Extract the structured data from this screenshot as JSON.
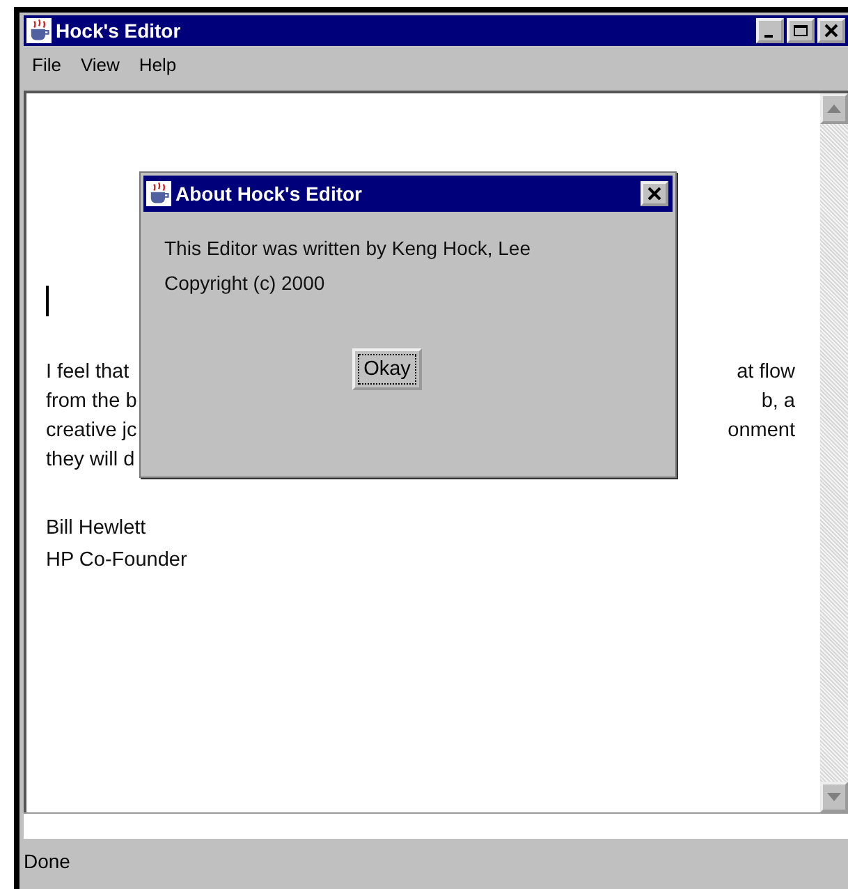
{
  "window": {
    "title": "Hock's Editor"
  },
  "menu": [
    "File",
    "View",
    "Help"
  ],
  "editor": {
    "lines": [
      {
        "left": "I feel that",
        "right": "at flow"
      },
      {
        "left": "from the b",
        "right": "b, a"
      },
      {
        "left": "creative jc",
        "right": "onment"
      },
      {
        "left": "they will d"
      }
    ],
    "signature": [
      "Bill Hewlett",
      "HP Co-Founder"
    ]
  },
  "dialog": {
    "title": "About Hock's Editor",
    "lines": [
      "This Editor was written by Keng Hock, Lee",
      "Copyright (c) 2000"
    ],
    "button": "Okay"
  },
  "status_bar": "Done"
}
